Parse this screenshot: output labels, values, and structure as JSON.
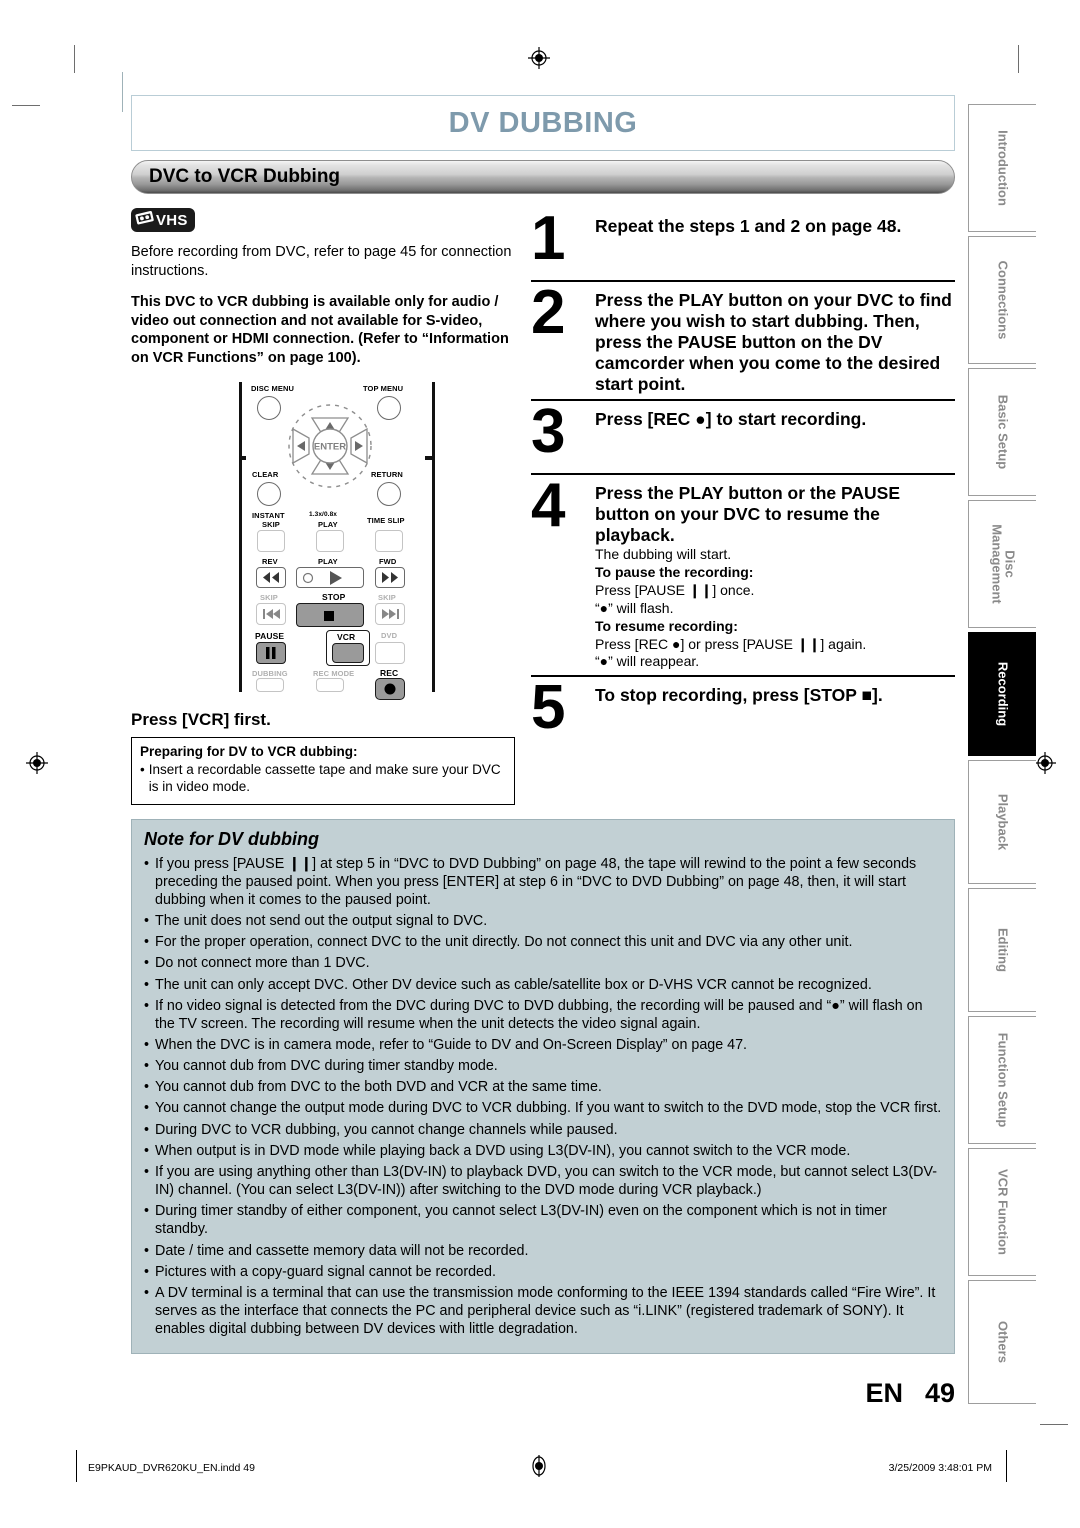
{
  "document": {
    "chapter_title": "DV DUBBING",
    "section_title": "DVC to VCR Dubbing",
    "title_color": "#7e9aac",
    "note_bg_color": "#c2d0d4"
  },
  "left_column": {
    "media_badge": {
      "icon": "vhs-cassette-icon",
      "label": "VHS"
    },
    "intro_paragraph": "Before recording from DVC, refer to page 45 for connection instructions.",
    "notice_paragraph": "This DVC to VCR dubbing is available only for audio / video out connection and not available for S-video, component or HDMI connection.  (Refer to “Information on VCR Functions” on page 100).",
    "press_vcr_heading": "Press [VCR] first.",
    "prepare_box": {
      "title": "Preparing for DV to VCR dubbing:",
      "bullet": "•",
      "items": [
        "Insert a recordable cassette tape and make sure your DVC is in video mode."
      ]
    }
  },
  "remote": {
    "name": "remote-control-diagram",
    "labels": {
      "disc_menu": "DISC MENU",
      "top_menu": "TOP MENU",
      "enter": "ENTER",
      "clear": "CLEAR",
      "return": "RETURN",
      "instant": "INSTANT",
      "instant_skip": "SKIP",
      "speed": "1.3x/0.8x",
      "speed_play": "PLAY",
      "time_slip": "TIME SLIP",
      "rev": "REV",
      "play": "PLAY",
      "fwd": "FWD",
      "skip_left": "SKIP",
      "stop": "STOP",
      "skip_right": "SKIP",
      "pause": "PAUSE",
      "vcr": "VCR",
      "dvd": "DVD",
      "dubbing": "DUBBING",
      "rec_mode": "REC MODE",
      "rec": "REC"
    }
  },
  "steps": [
    {
      "number": "1",
      "heading": "Repeat the steps 1 and 2 on page 48.",
      "sub": []
    },
    {
      "number": "2",
      "heading": "Press the PLAY button on your DVC to find where you wish to start dubbing. Then, press the PAUSE button on the DV camcorder when you come to the desired start point.",
      "sub": []
    },
    {
      "number": "3",
      "heading": "Press [REC ●] to start recording.",
      "sub": []
    },
    {
      "number": "4",
      "heading": "Press the PLAY button or the PAUSE button on your DVC to resume the playback.",
      "sub": [
        {
          "style": "normal",
          "text": "The dubbing will start."
        },
        {
          "style": "bold",
          "text": "To pause the recording:"
        },
        {
          "style": "normal",
          "text": "Press [PAUSE ❙❙] once."
        },
        {
          "style": "normal",
          "text": "“●” will flash."
        },
        {
          "style": "bold",
          "text": "To resume recording:"
        },
        {
          "style": "normal",
          "text": "Press [REC ●] or press [PAUSE ❙❙] again."
        },
        {
          "style": "normal",
          "text": "“●” will reappear."
        }
      ]
    },
    {
      "number": "5",
      "heading": "To stop recording, press [STOP ■].",
      "sub": []
    }
  ],
  "note": {
    "title": "Note for DV dubbing",
    "bullet": "•",
    "items": [
      "If you press [PAUSE ❙❙] at step 5 in “DVC to DVD Dubbing” on page 48, the tape will rewind to the point a few seconds preceding the paused point. When you press [ENTER] at step 6 in “DVC to DVD Dubbing” on page 48, then, it will start dubbing when it comes to the paused point.",
      "The unit does not send out the output signal to DVC.",
      "For the proper operation, connect DVC to the unit directly. Do not connect this unit and DVC via any other unit.",
      "Do not connect more than 1 DVC.",
      "The unit can only accept DVC. Other DV device such as cable/satellite box or D-VHS VCR cannot be recognized.",
      "If no video signal is detected from the DVC during DVC to DVD dubbing, the recording will be paused and “●” will flash on the TV screen. The recording will resume when the unit detects the video signal again.",
      "When the DVC is in camera mode, refer to “Guide to DV and On-Screen Display” on page 47.",
      "You cannot dub from DVC during timer standby mode.",
      "You cannot dub from DVC to the both DVD and VCR at the same time.",
      "You cannot change the output mode during DVC to VCR dubbing. If you want to switch to the DVD mode, stop the VCR first.",
      "During DVC to VCR dubbing, you cannot change channels while paused.",
      "When output is in DVD mode while playing back a DVD using L3(DV-IN), you cannot switch to the VCR mode.",
      "If you are using anything other than L3(DV-IN) to playback DVD, you can switch to the VCR mode, but cannot select L3(DV-IN) channel. (You can select L3(DV-IN)) after switching to the DVD mode during VCR playback.)",
      "During timer standby of either component, you cannot select L3(DV-IN) even on the component which is not in timer standby.",
      "Date / time and cassette memory data will not be recorded.",
      "Pictures with a copy-guard signal cannot be recorded.",
      "A DV terminal is a terminal that can use the transmission mode conforming to the IEEE 1394 standards called “Fire Wire”. It serves as the interface that connects the PC and peripheral device such as “i.LINK” (registered trademark of SONY). It enables digital dubbing between DV devices with little degradation."
    ]
  },
  "side_tabs": [
    {
      "label": "Introduction",
      "active": false,
      "lines": 1
    },
    {
      "label": "Connections",
      "active": false,
      "lines": 1
    },
    {
      "label": "Basic Setup",
      "active": false,
      "lines": 1
    },
    {
      "label": "Disc\nManagement",
      "active": false,
      "lines": 2
    },
    {
      "label": "Recording",
      "active": true,
      "lines": 1
    },
    {
      "label": "Playback",
      "active": false,
      "lines": 1
    },
    {
      "label": "Editing",
      "active": false,
      "lines": 1
    },
    {
      "label": "Function Setup",
      "active": false,
      "lines": 1
    },
    {
      "label": "VCR Function",
      "active": false,
      "lines": 1
    },
    {
      "label": "Others",
      "active": false,
      "lines": 1
    }
  ],
  "footer": {
    "language_code": "EN",
    "page_number": "49",
    "slug_left": "E9PKAUD_DVR620KU_EN.indd   49",
    "slug_right": "3/25/2009   3:48:01 PM"
  }
}
